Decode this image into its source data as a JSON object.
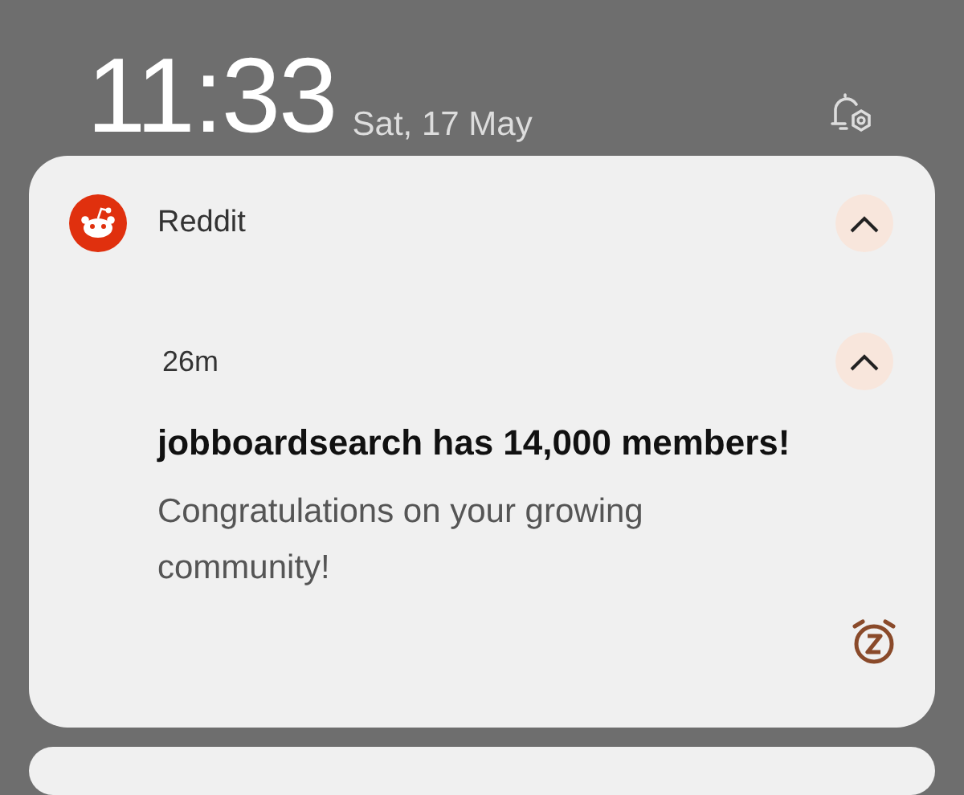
{
  "lock_screen": {
    "time": "11:33",
    "date": "Sat, 17 May"
  },
  "notification": {
    "app": "Reddit",
    "age": "26m",
    "title": "jobboardsearch has 14,000 members!",
    "body": "Congratulations on your growing community!"
  }
}
